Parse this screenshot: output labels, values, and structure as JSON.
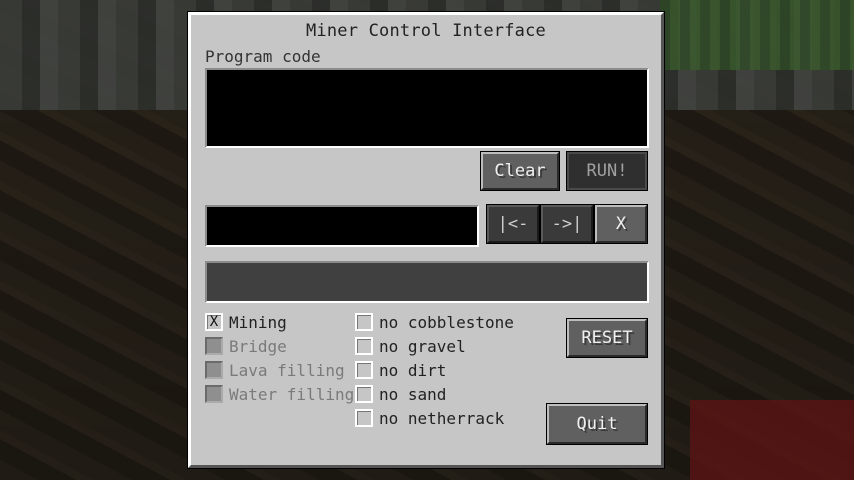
{
  "window": {
    "title": "Miner Control Interface"
  },
  "program": {
    "label": "Program code",
    "clear_label": "Clear",
    "run_label": "RUN!"
  },
  "editor": {
    "input_value": "",
    "prev_label": "|<-",
    "next_label": "->|",
    "delete_label": "X"
  },
  "status": {
    "text": ""
  },
  "modes": [
    {
      "label": "Mining",
      "checked": true,
      "enabled": true
    },
    {
      "label": "Bridge",
      "checked": false,
      "enabled": false
    },
    {
      "label": "Lava filling",
      "checked": false,
      "enabled": false
    },
    {
      "label": "Water filling",
      "checked": false,
      "enabled": false
    }
  ],
  "filters": [
    {
      "label": "no cobblestone",
      "checked": false
    },
    {
      "label": "no gravel",
      "checked": false
    },
    {
      "label": "no dirt",
      "checked": false
    },
    {
      "label": "no sand",
      "checked": false
    },
    {
      "label": "no netherrack",
      "checked": false
    }
  ],
  "actions": {
    "reset_label": "RESET",
    "quit_label": "Quit"
  },
  "check_mark": "X"
}
